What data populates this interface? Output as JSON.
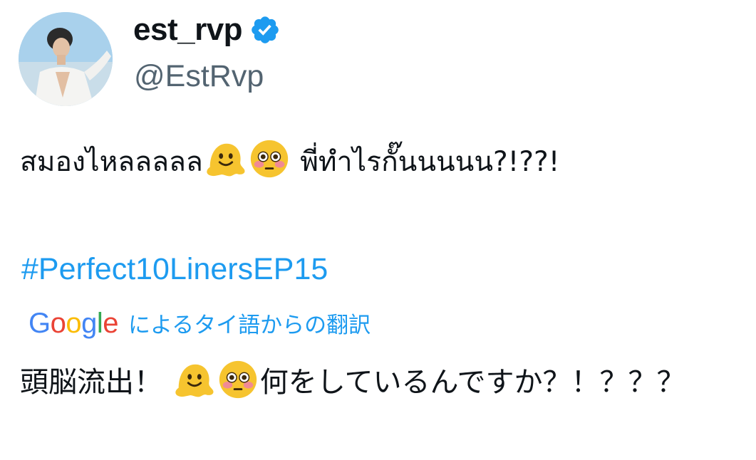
{
  "author": {
    "display_name": "est_rvp",
    "handle": "@EstRvp",
    "verified_icon": "verified-badge-icon",
    "badge_color": "#1d9bf0"
  },
  "tweet": {
    "text_part1": "สมองไหลลลลล",
    "text_part2": " พี่ทำไรกั๊นนนนน?!??!",
    "emojis": [
      "melting-face-emoji",
      "flushed-face-emoji"
    ],
    "hashtag": "#Perfect10LinersEP15"
  },
  "translation": {
    "provider_logo": "Google",
    "label": "によるタイ語からの翻訳",
    "text_part1": "頭脳流出！ ",
    "text_part2": "何をしているんですか？！？？？"
  },
  "colors": {
    "link": "#1d9bf0",
    "text": "#0f1419",
    "secondary": "#536471"
  }
}
